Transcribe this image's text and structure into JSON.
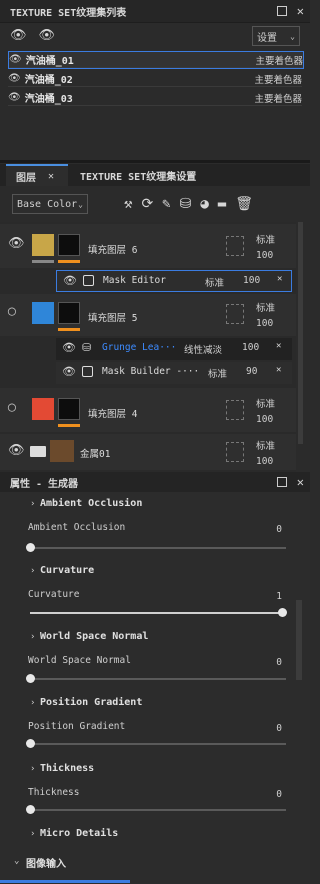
{
  "textureset_panel": {
    "title": "TEXTURE SET纹理集列表",
    "settings_label": "设置",
    "rows": [
      {
        "name": "汽油桶_01",
        "shader": "主要着色器"
      },
      {
        "name": "汽油桶_02",
        "shader": "主要着色器"
      },
      {
        "name": "汽油桶_03",
        "shader": "主要着色器"
      }
    ]
  },
  "tabs": {
    "layers": "图层",
    "textureset_settings": "TEXTURE SET纹理集设置"
  },
  "layers_toolbar": {
    "channel_select": "Base Color"
  },
  "layers": [
    {
      "name": "填充图层 6",
      "blend": "标准",
      "opacity": "100",
      "color": "#c8a648"
    },
    {
      "name": "Mask Editor",
      "blend": "标准",
      "opacity": "100"
    },
    {
      "name": "填充图层 5",
      "blend": "标准",
      "opacity": "100",
      "color": "#2f86d9"
    },
    {
      "name": "Grunge Lea···",
      "blend": "线性减淡",
      "opacity": "100"
    },
    {
      "name": "Mask Builder -···",
      "blend": "标准",
      "opacity": "90"
    },
    {
      "name": "填充图层 4",
      "blend": "标准",
      "opacity": "100",
      "color": "#e34a34"
    },
    {
      "name": "金属01",
      "blend": "标准",
      "opacity": "100"
    }
  ],
  "properties_panel": {
    "title": "属性 - 生成器",
    "sections": [
      {
        "title": "Ambient Occlusion",
        "label": "Ambient Occlusion",
        "value": "0",
        "fraction": 0
      },
      {
        "title": "Curvature",
        "label": "Curvature",
        "value": "1",
        "fraction": 1
      },
      {
        "title": "World Space Normal",
        "label": "World Space Normal",
        "value": "0",
        "fraction": 0
      },
      {
        "title": "Position Gradient",
        "label": "Position Gradient",
        "value": "0",
        "fraction": 0
      },
      {
        "title": "Thickness",
        "label": "Thickness",
        "value": "0",
        "fraction": 0
      }
    ],
    "micro_details": "Micro Details",
    "image_input": "图像输入"
  },
  "colors": {
    "accent": "#3b7ce0",
    "orange": "#f0901e",
    "link": "#3d8bff"
  }
}
